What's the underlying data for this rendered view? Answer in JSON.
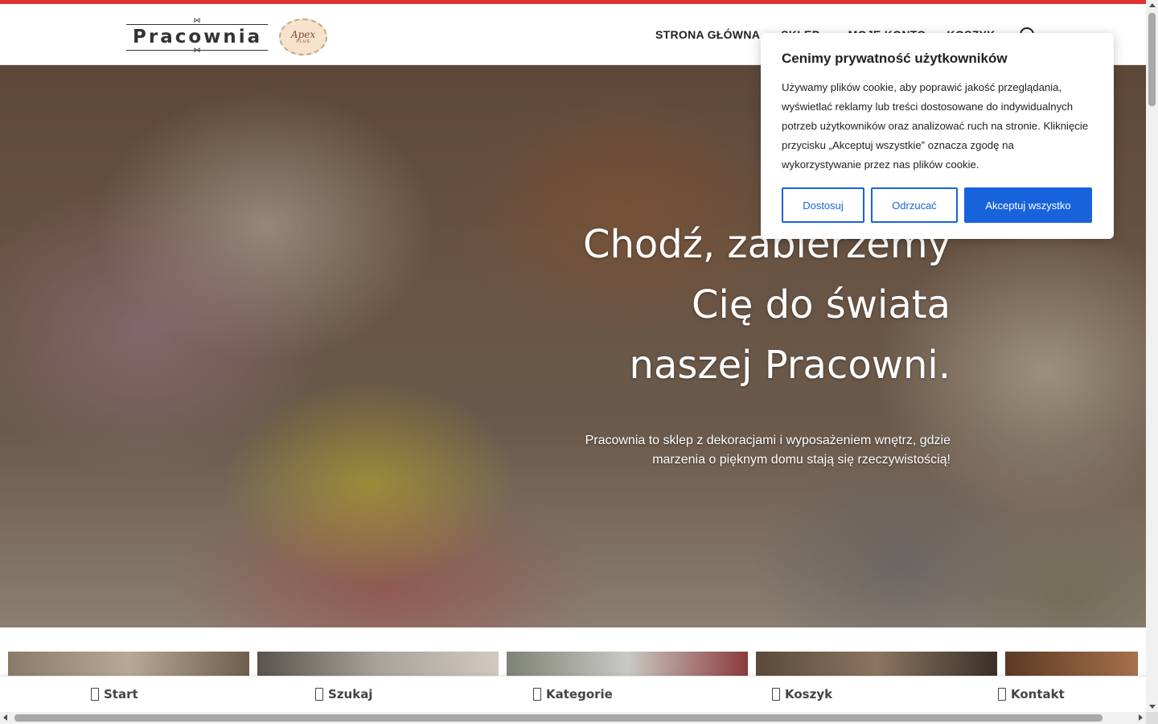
{
  "header": {
    "logo_text": "Pracownia",
    "seal_text": "Apex",
    "seal_subtext": "PLUS",
    "accent_color": "#dd3333",
    "nav": [
      {
        "label": "STRONA GŁÓWNA"
      },
      {
        "label": "SKLEP"
      },
      {
        "label": "MOJE KONTO"
      },
      {
        "label": "KOSZYK"
      }
    ]
  },
  "hero": {
    "title_lines": [
      "Chodź, zabierzemy",
      "Cię do świata",
      "naszej Pracowni."
    ],
    "subtitle": "Pracownia to sklep z dekoracjami i wyposażeniem wnętrz, gdzie marzenia o pięknym domu stają się rzeczywistością!"
  },
  "cookie": {
    "title": "Cenimy prywatność użytkowników",
    "text": "Używamy plików cookie, aby poprawić jakość przeglądania, wyświetlać reklamy lub treści dostosowane do indywidualnych potrzeb użytkowników oraz analizować ruch na stronie. Kliknięcie przycisku „Akceptuj wszystkie” oznacza zgodę na wykorzystywanie przez nas plików cookie.",
    "btn_customize": "Dostosuj",
    "btn_reject": "Odrzucać",
    "btn_accept": "Akceptuj wszystko",
    "button_color": "#1863dc"
  },
  "bottom_nav": [
    {
      "label": "Start",
      "icon": "home-icon"
    },
    {
      "label": "Szukaj",
      "icon": "search-icon"
    },
    {
      "label": "Kategorie",
      "icon": "categories-icon"
    },
    {
      "label": "Koszyk",
      "icon": "cart-icon"
    },
    {
      "label": "Kontakt",
      "icon": "contact-icon"
    }
  ]
}
